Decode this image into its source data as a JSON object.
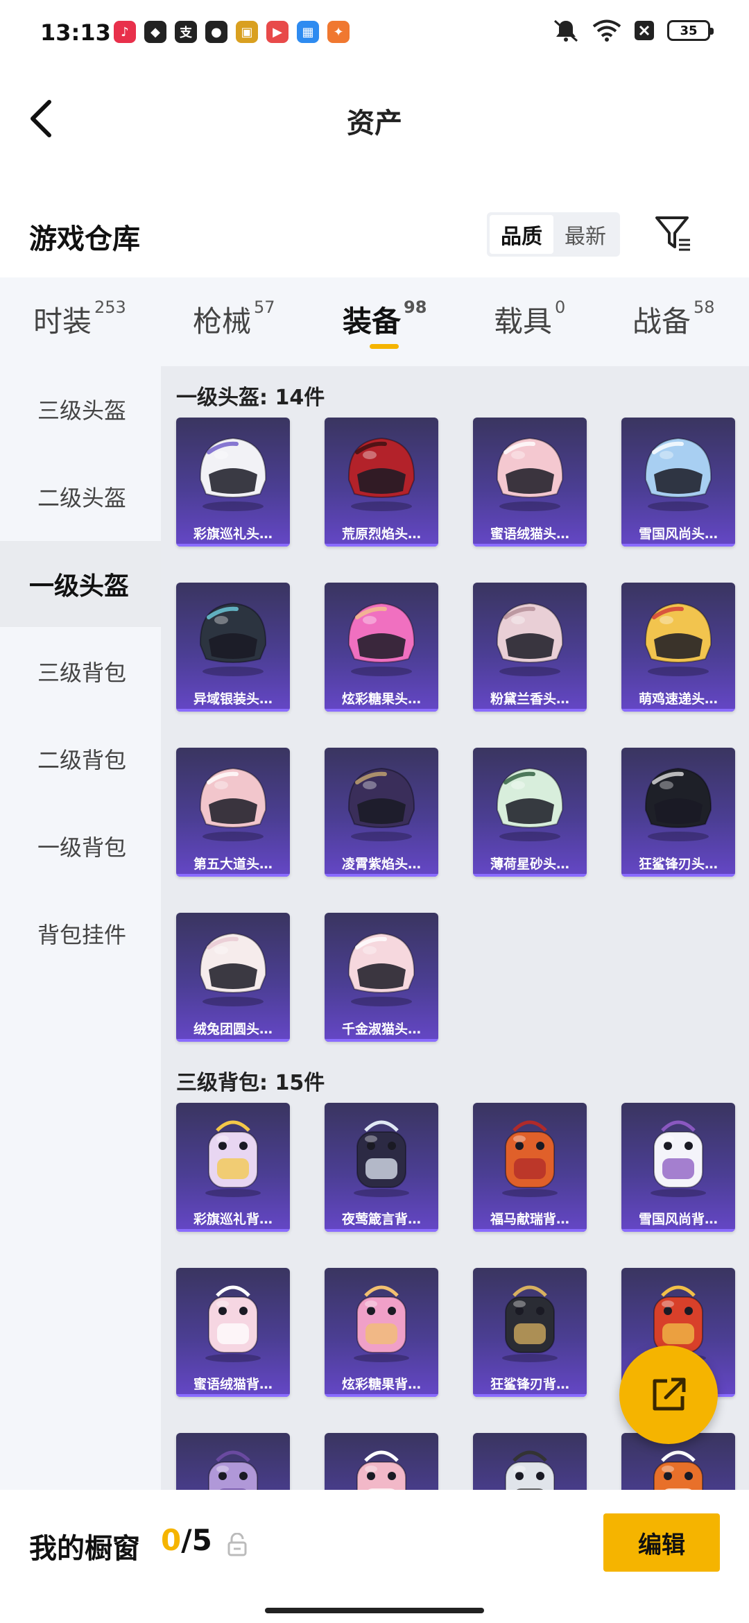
{
  "status": {
    "time": "13:13",
    "battery": "35",
    "apps": [
      {
        "icon": "music-app-icon",
        "color": "#e8304b",
        "glyph": "♪"
      },
      {
        "icon": "security-app-icon",
        "color": "#222222",
        "glyph": "◆"
      },
      {
        "icon": "alipay-app-icon",
        "color": "#222222",
        "glyph": "支"
      },
      {
        "icon": "wechat-app-icon",
        "color": "#222222",
        "glyph": "●"
      },
      {
        "icon": "game-app-icon",
        "color": "#d9a020",
        "glyph": "▣"
      },
      {
        "icon": "video-app-icon",
        "color": "#e84a4a",
        "glyph": "▶"
      },
      {
        "icon": "calendar-app-icon",
        "color": "#2e8bf0",
        "glyph": "▦"
      },
      {
        "icon": "shop-app-icon",
        "color": "#f07830",
        "glyph": "✦"
      }
    ]
  },
  "header": {
    "title": "资产"
  },
  "warehouse": {
    "title": "游戏仓库",
    "sort_options": [
      "品质",
      "最新"
    ],
    "active_sort": "品质"
  },
  "tabs": [
    {
      "label": "时装",
      "count": "253"
    },
    {
      "label": "枪械",
      "count": "57"
    },
    {
      "label": "装备",
      "count": "98"
    },
    {
      "label": "载具",
      "count": "0"
    },
    {
      "label": "战备",
      "count": "58"
    }
  ],
  "active_tab": "装备",
  "sidebar": [
    {
      "label": "三级头盔"
    },
    {
      "label": "二级头盔"
    },
    {
      "label": "一级头盔"
    },
    {
      "label": "三级背包"
    },
    {
      "label": "二级背包"
    },
    {
      "label": "一级背包"
    },
    {
      "label": "背包挂件"
    }
  ],
  "active_sidebar": "一级头盔",
  "sections": [
    {
      "title": "一级头盔: 14件",
      "items": [
        {
          "label": "彩旗巡礼头…",
          "color": "#f2f2f6",
          "accent": "#6a58c8",
          "kind": "helmet"
        },
        {
          "label": "荒原烈焰头…",
          "color": "#b3222a",
          "accent": "#3a1010",
          "kind": "helmet"
        },
        {
          "label": "蜜语绒猫头…",
          "color": "#f4c8d0",
          "accent": "#ffffff",
          "kind": "helmet"
        },
        {
          "label": "雪国风尚头…",
          "color": "#a8cff2",
          "accent": "#ffffff",
          "kind": "helmet"
        },
        {
          "label": "异域银装头…",
          "color": "#2c3440",
          "accent": "#6fd0e0",
          "kind": "helmet"
        },
        {
          "label": "炫彩糖果头…",
          "color": "#f070c0",
          "accent": "#f3c48a",
          "kind": "helmet"
        },
        {
          "label": "粉黛兰香头…",
          "color": "#e9cfd6",
          "accent": "#b08a94",
          "kind": "helmet"
        },
        {
          "label": "萌鸡速递头…",
          "color": "#f2c44e",
          "accent": "#d23a3a",
          "kind": "helmet"
        },
        {
          "label": "第五大道头…",
          "color": "#f2c6cc",
          "accent": "#ffffff",
          "kind": "helmet"
        },
        {
          "label": "凌霄紫焰头…",
          "color": "#3a2e5a",
          "accent": "#c7a870",
          "kind": "helmet"
        },
        {
          "label": "薄荷星砂头…",
          "color": "#d8eedc",
          "accent": "#2a5a3a",
          "kind": "helmet"
        },
        {
          "label": "狂鲨锋刃头…",
          "color": "#1e2028",
          "accent": "#e0e0e0",
          "kind": "helmet"
        },
        {
          "label": "绒兔团圆头…",
          "color": "#f6ecec",
          "accent": "#e8c8d2",
          "kind": "helmet"
        },
        {
          "label": "千金淑猫头…",
          "color": "#f6d8de",
          "accent": "#ffffff",
          "kind": "helmet"
        }
      ]
    },
    {
      "title": "三级背包: 15件",
      "items": [
        {
          "label": "彩旗巡礼背…",
          "color": "#e8d6f2",
          "accent": "#f4c848",
          "kind": "backpack"
        },
        {
          "label": "夜莺箴言背…",
          "color": "#2c2a44",
          "accent": "#e0e8f4",
          "kind": "backpack"
        },
        {
          "label": "福马献瑞背…",
          "color": "#e0602a",
          "accent": "#b02a2a",
          "kind": "backpack"
        },
        {
          "label": "雪国风尚背…",
          "color": "#f4f4fa",
          "accent": "#8a58c0",
          "kind": "backpack"
        },
        {
          "label": "蜜语绒猫背…",
          "color": "#f6d6e2",
          "accent": "#ffffff",
          "kind": "backpack"
        },
        {
          "label": "炫彩糖果背…",
          "color": "#f0a0c8",
          "accent": "#f2c070",
          "kind": "backpack"
        },
        {
          "label": "狂鲨锋刃背…",
          "color": "#2a2c34",
          "accent": "#d8b060",
          "kind": "backpack"
        },
        {
          "label": "",
          "color": "#d8402a",
          "accent": "#f2c048",
          "kind": "backpack"
        },
        {
          "label": "",
          "color": "#b098d8",
          "accent": "#6a4aa0",
          "kind": "backpack"
        },
        {
          "label": "",
          "color": "#f2b8c8",
          "accent": "#ffffff",
          "kind": "backpack"
        },
        {
          "label": "",
          "color": "#e0e4ea",
          "accent": "#333333",
          "kind": "backpack"
        },
        {
          "label": "",
          "color": "#e8702a",
          "accent": "#ffffff",
          "kind": "backpack"
        }
      ]
    }
  ],
  "showcase": {
    "title": "我的橱窗",
    "current": "0",
    "total": "/5",
    "edit_label": "编辑"
  },
  "colors": {
    "accent": "#f5b400",
    "card_top": "#3a3560",
    "card_bottom": "#6547c7"
  }
}
